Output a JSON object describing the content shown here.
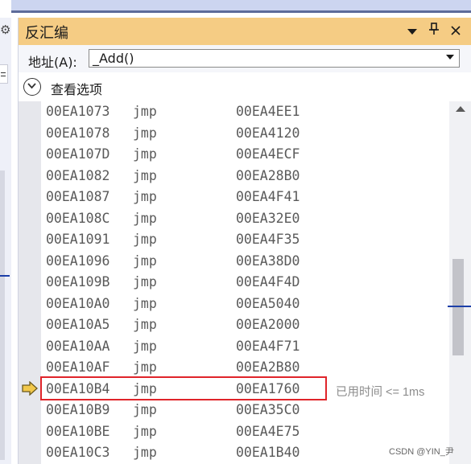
{
  "window": {
    "title": "反汇编",
    "buttons": {
      "dropdown": "▼",
      "pin": "📌",
      "close": "✕"
    }
  },
  "address": {
    "label": "地址(A):",
    "value": "_Add()"
  },
  "options": {
    "label": "查看选项"
  },
  "instructions": [
    {
      "addr": "00EA1073",
      "op": "jmp",
      "target": "00EA4EE1"
    },
    {
      "addr": "00EA1078",
      "op": "jmp",
      "target": "00EA4120"
    },
    {
      "addr": "00EA107D",
      "op": "jmp",
      "target": "00EA4ECF"
    },
    {
      "addr": "00EA1082",
      "op": "jmp",
      "target": "00EA28B0"
    },
    {
      "addr": "00EA1087",
      "op": "jmp",
      "target": "00EA4F41"
    },
    {
      "addr": "00EA108C",
      "op": "jmp",
      "target": "00EA32E0"
    },
    {
      "addr": "00EA1091",
      "op": "jmp",
      "target": "00EA4F35"
    },
    {
      "addr": "00EA1096",
      "op": "jmp",
      "target": "00EA38D0"
    },
    {
      "addr": "00EA109B",
      "op": "jmp",
      "target": "00EA4F4D"
    },
    {
      "addr": "00EA10A0",
      "op": "jmp",
      "target": "00EA5040"
    },
    {
      "addr": "00EA10A5",
      "op": "jmp",
      "target": "00EA2000"
    },
    {
      "addr": "00EA10AA",
      "op": "jmp",
      "target": "00EA4F71"
    },
    {
      "addr": "00EA10AF",
      "op": "jmp",
      "target": "00EA2B80"
    },
    {
      "addr": "00EA10B4",
      "op": "jmp",
      "target": "00EA1760",
      "current": true,
      "elapsed": "已用时间 <= 1ms"
    },
    {
      "addr": "00EA10B9",
      "op": "jmp",
      "target": "00EA35C0"
    },
    {
      "addr": "00EA10BE",
      "op": "jmp",
      "target": "00EA4E75"
    },
    {
      "addr": "00EA10C3",
      "op": "jmp",
      "target": "00EA1B40"
    }
  ],
  "watermark": "CSDN @YIN_尹",
  "colors": {
    "title_bar": "#f5cc84",
    "current_line_box": "#e0242a",
    "current_line_arrow": "#f2c84b"
  }
}
